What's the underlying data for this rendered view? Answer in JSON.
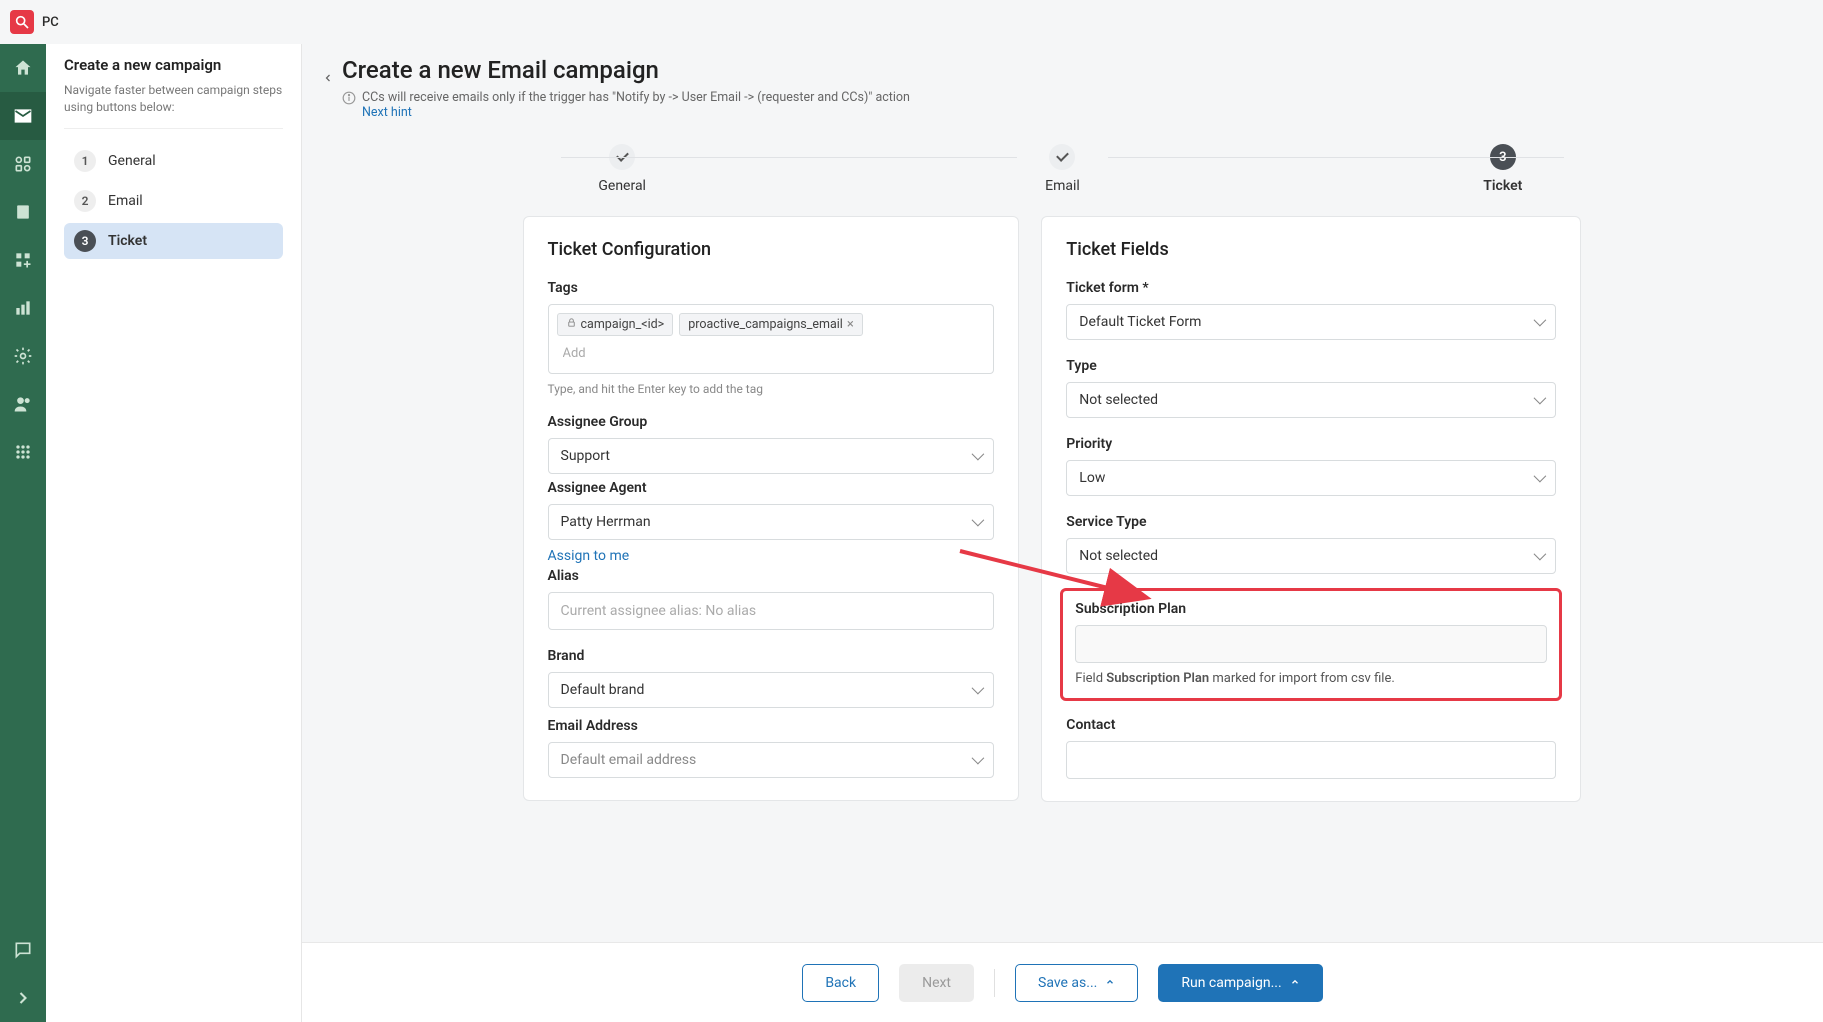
{
  "topbar": {
    "title": "PC"
  },
  "sidebar": {
    "title": "Create a new campaign",
    "subtitle": "Navigate faster between campaign steps using buttons below:",
    "steps": [
      {
        "num": "1",
        "label": "General"
      },
      {
        "num": "2",
        "label": "Email"
      },
      {
        "num": "3",
        "label": "Ticket"
      }
    ]
  },
  "header": {
    "title": "Create a new Email campaign",
    "hint": "CCs will receive emails only if the trigger has \"Notify by -> User Email -> (requester and CCs)\" action",
    "nextHint": "Next hint"
  },
  "progress": {
    "steps": [
      {
        "label": "General",
        "state": "done"
      },
      {
        "label": "Email",
        "state": "done"
      },
      {
        "label": "Ticket",
        "state": "current",
        "num": "3"
      }
    ]
  },
  "ticketConfig": {
    "title": "Ticket Configuration",
    "tagsLabel": "Tags",
    "tags": [
      {
        "text": "campaign_<id>",
        "locked": true
      },
      {
        "text": "proactive_campaigns_email",
        "locked": false
      }
    ],
    "tagsPlaceholder": "Add",
    "tagsHelper": "Type, and hit the Enter key to add the tag",
    "assigneeGroupLabel": "Assignee Group",
    "assigneeGroupValue": "Support",
    "assigneeAgentLabel": "Assignee Agent",
    "assigneeAgentValue": "Patty Herrman",
    "assignToMe": "Assign to me",
    "aliasLabel": "Alias",
    "aliasPlaceholder": "Current assignee alias: No alias",
    "brandLabel": "Brand",
    "brandValue": "Default brand",
    "emailAddrLabel": "Email Address",
    "emailAddrValue": "Default email address"
  },
  "ticketFields": {
    "title": "Ticket Fields",
    "formLabel": "Ticket form *",
    "formValue": "Default Ticket Form",
    "typeLabel": "Type",
    "typeValue": "Not selected",
    "priorityLabel": "Priority",
    "priorityValue": "Low",
    "serviceTypeLabel": "Service Type",
    "serviceTypeValue": "Not selected",
    "subPlanLabel": "Subscription Plan",
    "subPlanNotePrefix": "Field ",
    "subPlanNoteStrong": "Subscription Plan",
    "subPlanNoteSuffix": " marked for import from csv file.",
    "contactLabel": "Contact"
  },
  "footer": {
    "back": "Back",
    "next": "Next",
    "saveAs": "Save as...",
    "run": "Run campaign..."
  }
}
